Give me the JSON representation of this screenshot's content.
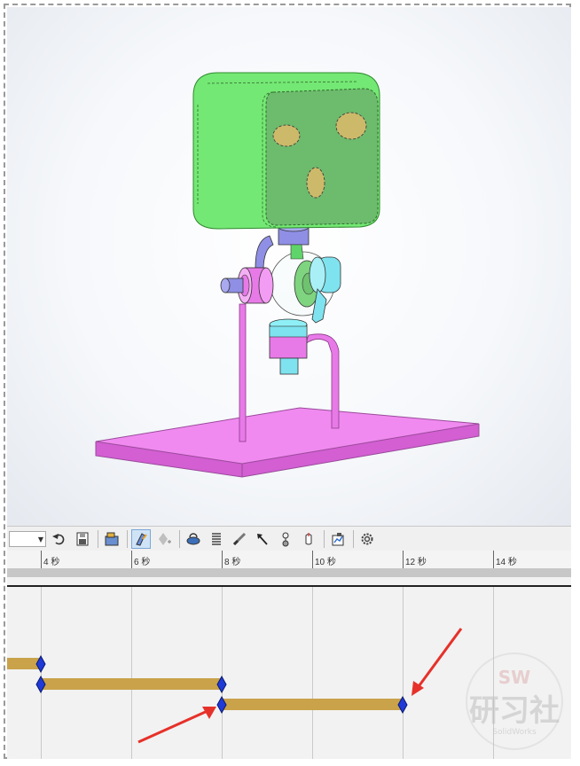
{
  "colors": {
    "head": "#74e874",
    "face": "#6dbb6d",
    "eye": "#cdb96a",
    "arm": "#e87ae8",
    "cyan": "#7ee3ef",
    "purple": "#8f8fe6",
    "keyframe": "#1f3ad6",
    "bar": "#c9a24a",
    "arrow": "#e6312a"
  },
  "toolbar": {
    "icons": [
      "loop-mode-icon",
      "save-animation-icon",
      "camera-icon",
      "autokey-icon",
      "add-key-icon",
      "motor-icon",
      "spring-icon",
      "damper-icon",
      "force-icon",
      "contact-icon",
      "gravity-icon",
      "results-icon",
      "settings-icon"
    ]
  },
  "timeline": {
    "ticks": [
      "4 秒",
      "6 秒",
      "8 秒",
      "10 秒",
      "12 秒",
      "14 秒"
    ]
  },
  "watermark": {
    "sw": "SW",
    "cn": "研习社",
    "brand": "SolidWorks"
  }
}
